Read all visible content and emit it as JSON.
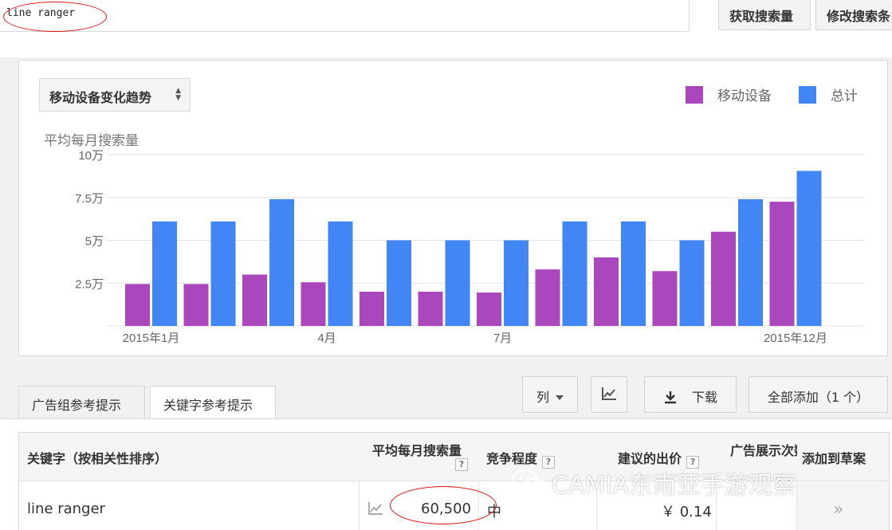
{
  "search": {
    "query": "line ranger",
    "get_volume_button": "获取搜索量",
    "modify_search_button": "修改搜索条"
  },
  "chart_panel": {
    "trend_select_label": "移动设备变化趋势",
    "y_axis_title": "平均每月搜索量",
    "legend": [
      {
        "name": "移动设备",
        "color": "#ab47bc"
      },
      {
        "name": "总计",
        "color": "#4285f4"
      }
    ]
  },
  "chart_data": {
    "type": "bar",
    "ylabel": "平均每月搜索量",
    "y_ticks": [
      "2.5万",
      "5万",
      "7.5万",
      "10万"
    ],
    "x_tick_labels": [
      {
        "index": 0,
        "label": "2015年1月"
      },
      {
        "index": 3,
        "label": "4月"
      },
      {
        "index": 6,
        "label": "7月"
      },
      {
        "index": 11,
        "label": "2015年12月"
      }
    ],
    "categories": [
      "2015-01",
      "2015-02",
      "2015-03",
      "2015-04",
      "2015-05",
      "2015-06",
      "2015-07",
      "2015-08",
      "2015-09",
      "2015-10",
      "2015-11",
      "2015-12"
    ],
    "ylim": [
      0,
      100000
    ],
    "grid": true,
    "legend_position": "top-right",
    "series": [
      {
        "name": "移动设备",
        "color": "#ab47bc",
        "values": [
          24500,
          24500,
          30000,
          25500,
          20000,
          20000,
          19500,
          33000,
          40000,
          32000,
          55000,
          72500
        ]
      },
      {
        "name": "总计",
        "color": "#4285f4",
        "values": [
          61000,
          61000,
          74000,
          61000,
          50000,
          50000,
          50000,
          61000,
          61000,
          50000,
          74000,
          90500
        ]
      }
    ]
  },
  "tabs": [
    {
      "label": "广告组参考提示",
      "active": false
    },
    {
      "label": "关键字参考提示",
      "active": true
    }
  ],
  "toolbar": {
    "columns_label": "列",
    "download_label": "下载",
    "add_all_label": "全部添加（1 个）"
  },
  "table": {
    "headers": {
      "keyword": "关键字（按相关性排序）",
      "avg_monthly": "平均每月搜索量",
      "competition": "竞争程度",
      "suggested_bid": "建议的出价",
      "ad_share": "广告展示次数份额",
      "add_to_draft": "添加到草案"
    },
    "rows": [
      {
        "keyword": "line ranger",
        "avg_monthly": "60,500",
        "competition": "中",
        "suggested_bid": "￥ 0.14",
        "add": "»"
      }
    ]
  },
  "watermark": "CAMIA东南亚手游观察"
}
